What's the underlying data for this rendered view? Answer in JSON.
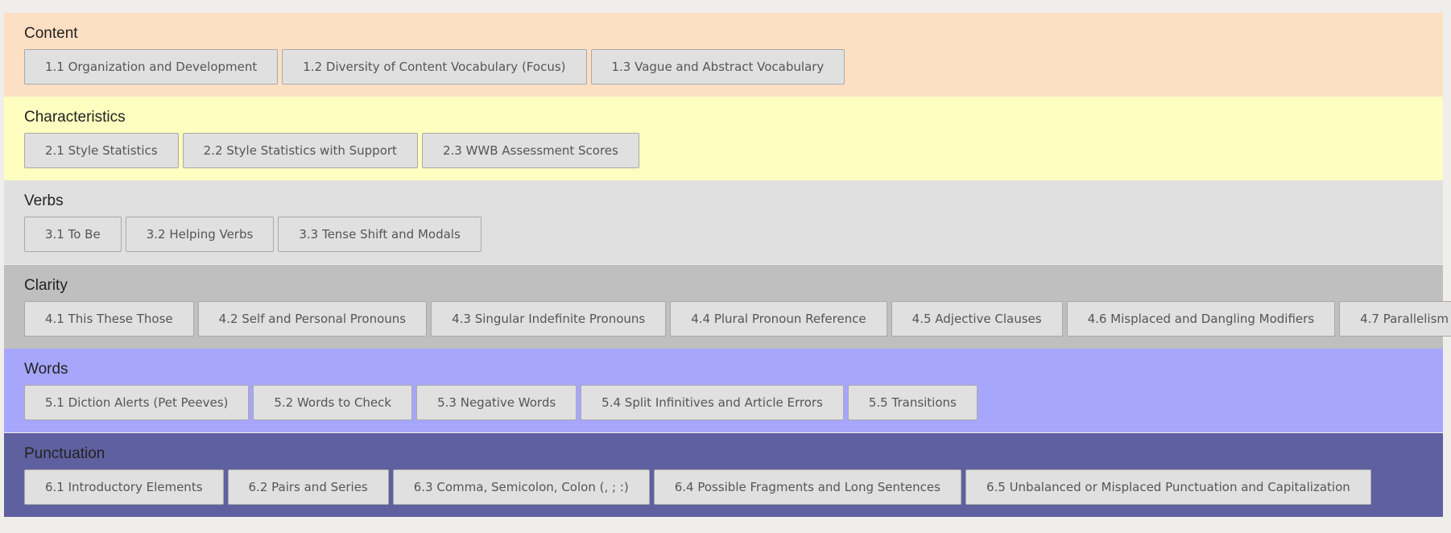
{
  "sections": [
    {
      "title": "Content",
      "color": "#fde0c4",
      "items": [
        "1.1 Organization and Development",
        "1.2 Diversity of Content Vocabulary (Focus)",
        "1.3 Vague and Abstract Vocabulary"
      ]
    },
    {
      "title": "Characteristics",
      "color": "#fefec0",
      "items": [
        "2.1 Style Statistics",
        "2.2 Style Statistics with Support",
        "2.3 WWB Assessment Scores"
      ]
    },
    {
      "title": "Verbs",
      "color": "#e0e0e0",
      "items": [
        "3.1 To Be",
        "3.2 Helping Verbs",
        "3.3 Tense Shift and Modals"
      ]
    },
    {
      "title": "Clarity",
      "color": "#bfbfbf",
      "items": [
        "4.1 This These Those",
        "4.2 Self and Personal Pronouns",
        "4.3 Singular Indefinite Pronouns",
        "4.4 Plural Pronoun Reference",
        "4.5 Adjective Clauses",
        "4.6 Misplaced and Dangling Modifiers",
        "4.7 Parallelism"
      ]
    },
    {
      "title": "Words",
      "color": "#a6a6fd",
      "items": [
        "5.1 Diction Alerts (Pet Peeves)",
        "5.2 Words to Check",
        "5.3 Negative Words",
        "5.4 Split Infinitives and Article Errors",
        "5.5 Transitions"
      ]
    },
    {
      "title": "Punctuation",
      "color": "#5f609f",
      "items": [
        "6.1 Introductory Elements",
        "6.2 Pairs and Series",
        "6.3 Comma, Semicolon, Colon (, ; :)",
        "6.4 Possible Fragments and Long Sentences",
        "6.5 Unbalanced or Misplaced Punctuation and Capitalization"
      ]
    }
  ]
}
